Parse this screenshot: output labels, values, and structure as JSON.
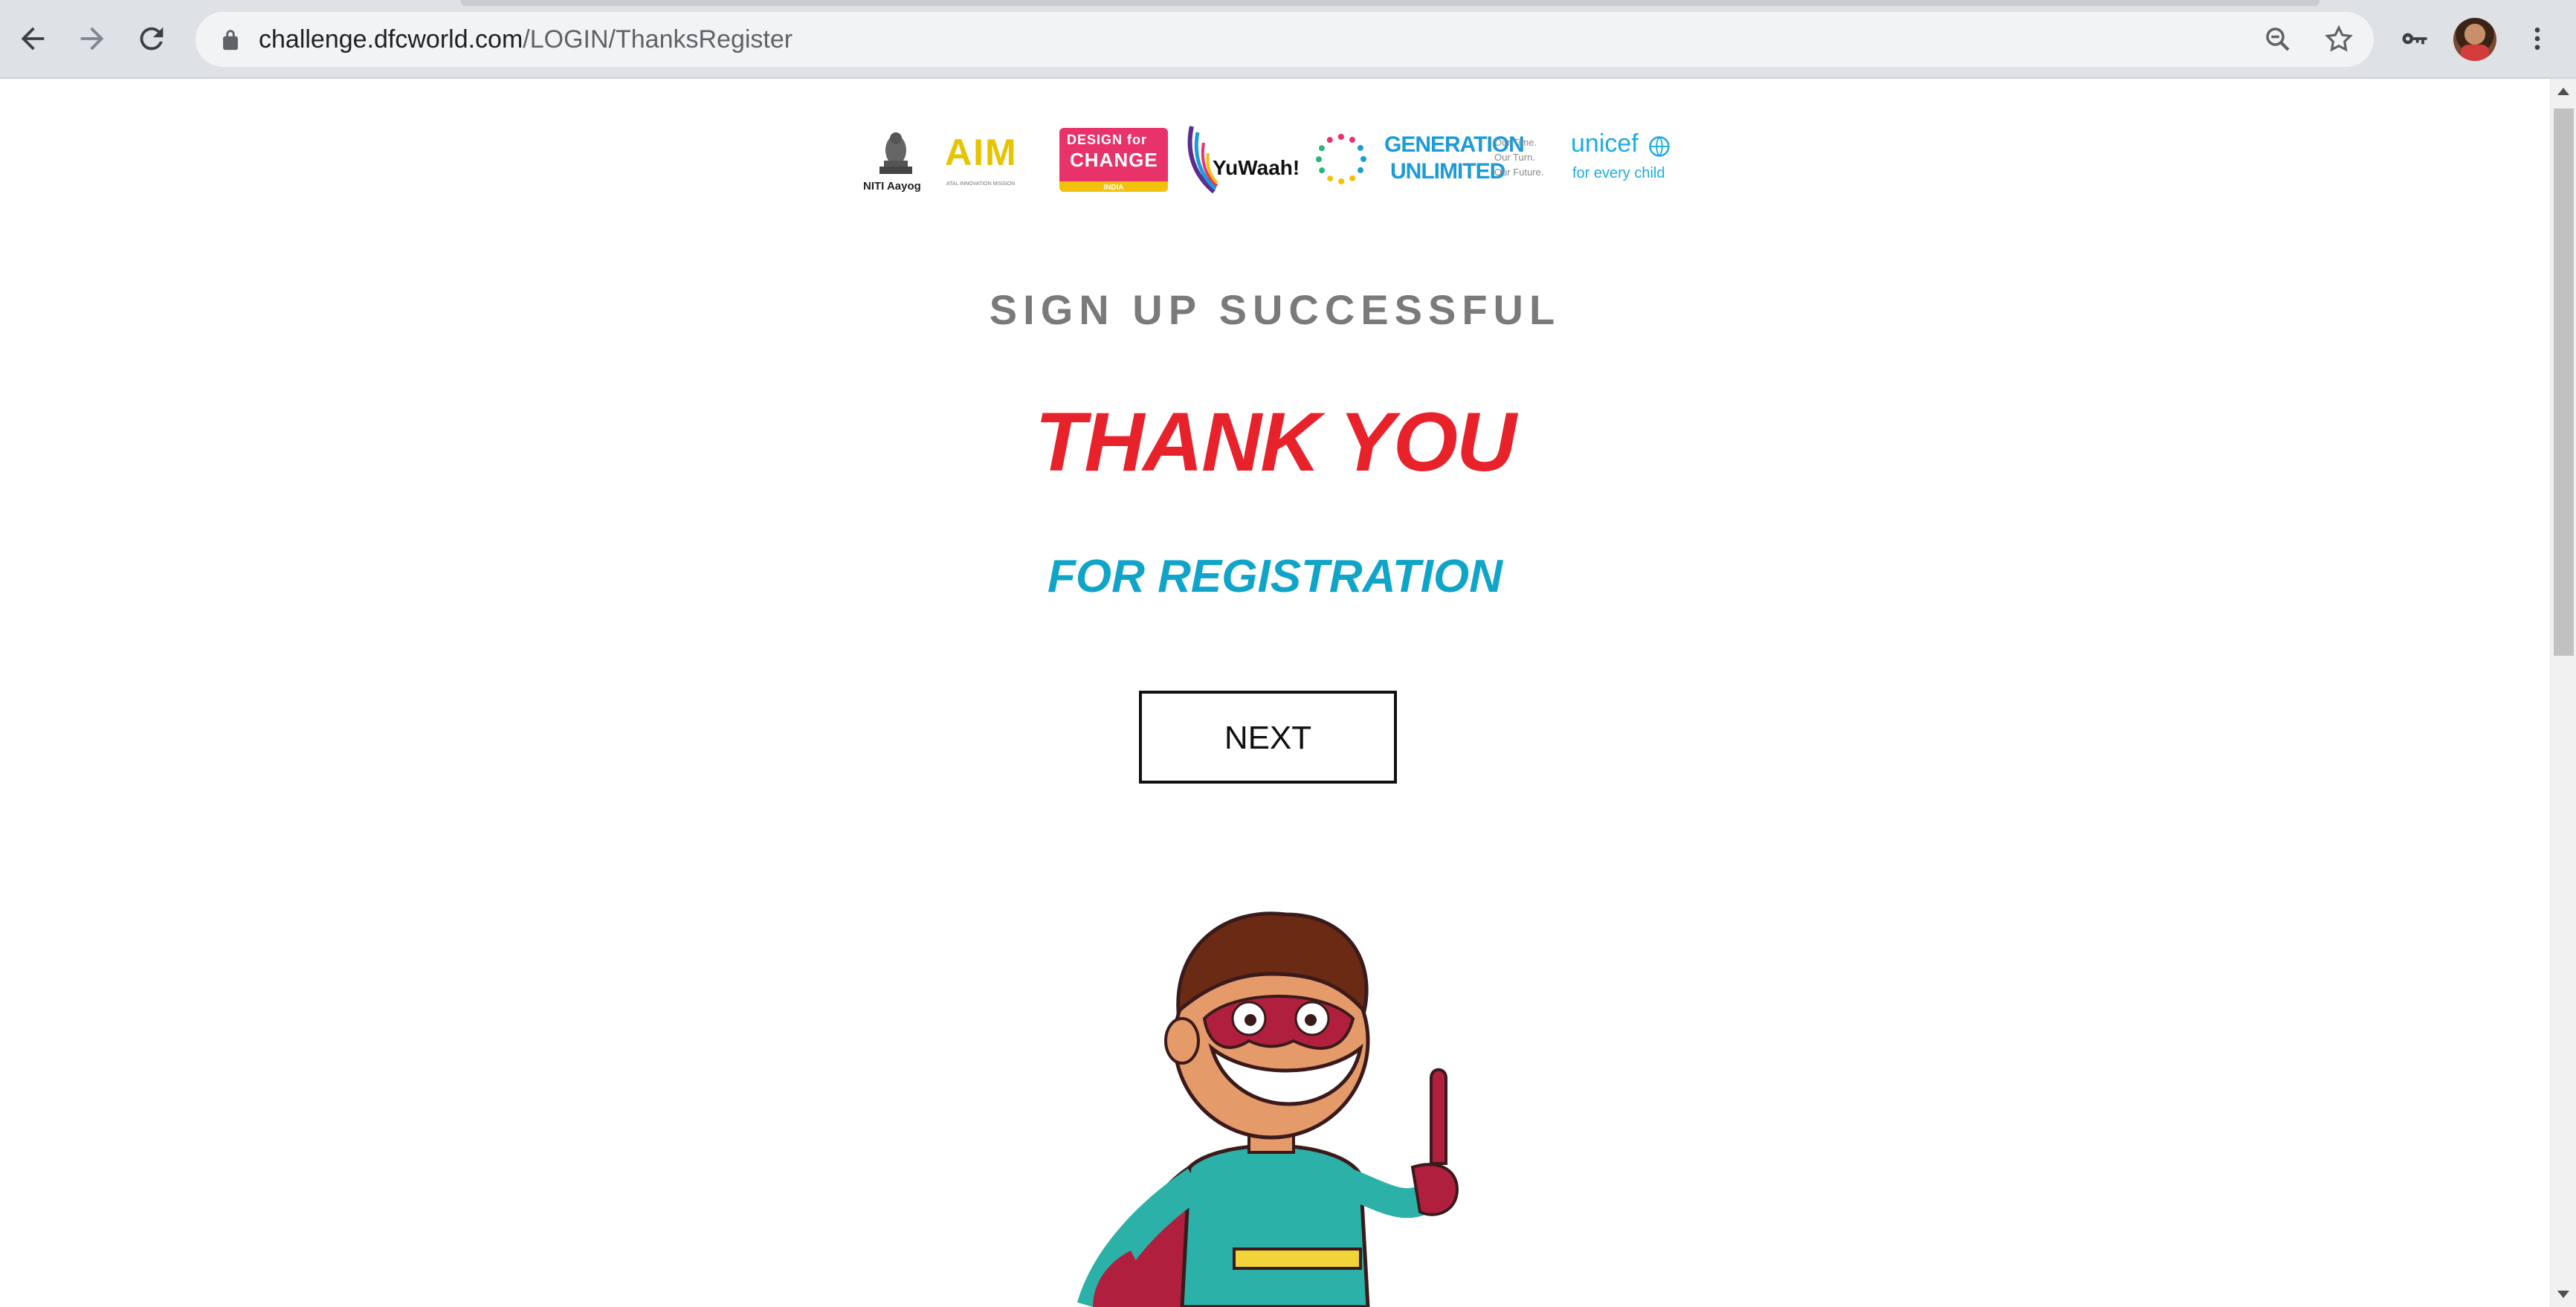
{
  "browser": {
    "url_host": "challenge.dfcworld.com",
    "url_path": "/LOGIN/ThanksRegister"
  },
  "logos": {
    "emblem_caption": "NITI Aayog",
    "aim_word": "AIM",
    "aim_sub": "ATAL INNOVATION MISSION",
    "dfc_line1": "DESIGN for",
    "dfc_line2": "CHANGE",
    "dfc_line3": "INDIA",
    "yuwaah": "YuWaah!",
    "gen_line1": "GENERATION",
    "gen_line2": "UNLIMITED",
    "gen_side": [
      "Our Time.",
      "Our Turn.",
      "Our Future."
    ],
    "unicef_name": "unicef",
    "unicef_tagline": "for every child"
  },
  "page": {
    "status": "SIGN UP SUCCESSFUL",
    "headline": "THANK YOU",
    "subheadline": "FOR REGISTRATION",
    "next_button": "NEXT"
  },
  "colors": {
    "headline": "#e8222a",
    "subheadline": "#10a5c8",
    "status": "#7a7a7a"
  }
}
